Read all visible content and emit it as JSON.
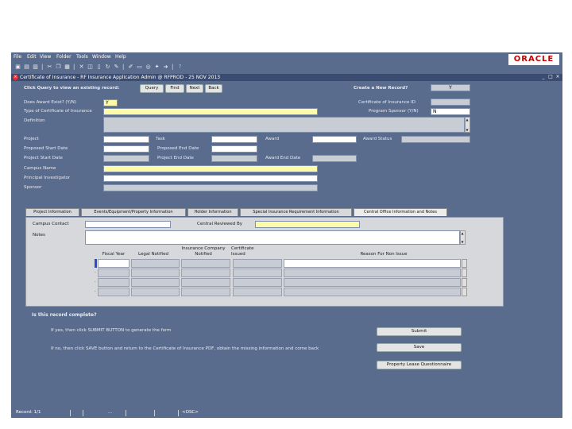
{
  "menu": [
    "File",
    "Edit",
    "View",
    "Folder",
    "Tools",
    "Window",
    "Help"
  ],
  "logo": "ORACLE",
  "toolbar_icons": [
    "save-icon",
    "print-icon",
    "open-icon",
    "separator",
    "cut-icon",
    "copy-icon",
    "paste-icon",
    "separator",
    "delete-icon",
    "translation-icon",
    "separator",
    "zoom-icon",
    "attachments-icon",
    "folder-icon",
    "help-icon"
  ],
  "window": {
    "title": "Certificate of Insurance - RF Insurance Application Admin @ RFPROD - 25 NOV 2013"
  },
  "query": {
    "prompt": "Click Query to view an existing record:",
    "buttons": [
      "Query",
      "Find",
      "Next",
      "Back"
    ],
    "create_label": "Create a  New Record?",
    "create_value": "Y"
  },
  "header": {
    "does_award_exist_label": "Does Award Exist? (Y/N)",
    "does_award_exist_value": "Y",
    "type_label": "Type of Certificate of Insurance",
    "type_value": "",
    "definition_label": "Definition",
    "definition_value": "",
    "cert_id_label": "Certificate of Insurance ID",
    "cert_id_value": "",
    "program_sponsor_label": "Program Sponsor (Y/N)",
    "program_sponsor_value": "N"
  },
  "project": {
    "project_label": "Project",
    "project_value": "",
    "task_label": "Task",
    "task_value": "",
    "award_label": "Award",
    "award_value": "",
    "award_status_label": "Award Status",
    "award_status_value": "",
    "proj_start_label": "Proposed Start Date",
    "proj_start_value": "",
    "proposed_end_label": "Proposed End Date",
    "proposed_end_value": "",
    "project_start_label": "Project Start Date",
    "project_start_value": "",
    "project_end_label": "Project End Date",
    "project_end_value": "",
    "award_end_label": "Award End Date",
    "award_end_value": "",
    "campus_name_label": "Campus Name",
    "campus_name_value": "",
    "pi_label": "Principal Investigator",
    "pi_value": "",
    "sponsor_label": "Sponsor",
    "sponsor_value": ""
  },
  "tabs": [
    {
      "label": "Project Information",
      "active": false
    },
    {
      "label": "Events/Equipment/Property Information",
      "active": false
    },
    {
      "label": "Holder Information",
      "active": false
    },
    {
      "label": "Special Insurance Requirement Information",
      "active": false
    },
    {
      "label": "Central Office Information and Notes",
      "active": true
    }
  ],
  "central": {
    "campus_contact_label": "Campus Contact",
    "campus_contact_value": "",
    "central_reviewed_label": "Central Reviewed By",
    "central_reviewed_value": "",
    "notes_label": "Notes",
    "notes_value": "",
    "columns": [
      "Fiscal Year",
      "Legal Notified",
      "Insurance Company Notified",
      "Certificate Issued",
      "Reason For Non Issue"
    ],
    "rows": [
      [
        "",
        "",
        "",
        "",
        ""
      ],
      [
        "",
        "",
        "",
        "",
        ""
      ],
      [
        "",
        "",
        "",
        "",
        ""
      ],
      [
        "",
        "",
        "",
        "",
        ""
      ]
    ]
  },
  "complete": {
    "question": "Is this record complete?",
    "line1": "If yes, then click SUBMIT BUTTON to generate the form",
    "line2": "If no, then click SAVE button and return to the Certificate of Insurance PDF, obtain the missing information and come back",
    "submit": "Submit",
    "save": "Save",
    "questionnaire": "Property Lease Questionnaire"
  },
  "status": {
    "record": "Record: 1/1",
    "dots": "...",
    "osc": "<OSC>"
  }
}
